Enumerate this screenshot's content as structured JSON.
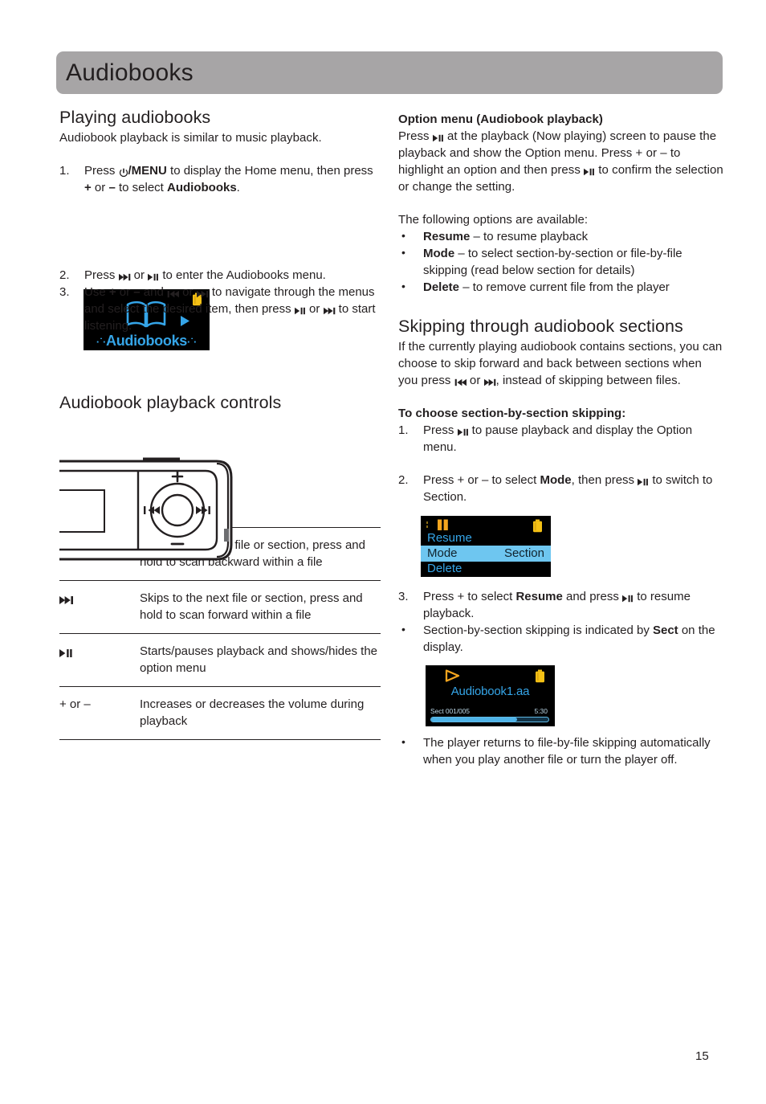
{
  "header": {
    "title": "Audiobooks"
  },
  "page_number": "15",
  "colors": {
    "header_bar": "#a7a5a6",
    "lcd_text_blue": "#35a5e8",
    "lcd_highlight": "#6ec6f0",
    "lcd_battery_yellow": "#f5c115",
    "lcd_accent_orange": "#f5a51e",
    "text": "#231f20"
  },
  "left_column": {
    "playing": {
      "heading": "Playing audiobooks",
      "intro": "Audiobook playback is similar to music playback.",
      "steps": [
        {
          "num": "1.",
          "parts": [
            {
              "t": "Press ",
              "s": "n"
            },
            {
              "t": "/MENU",
              "s": "b"
            },
            {
              "t": " to display the Home menu, then press ",
              "s": "n"
            },
            {
              "t": "+",
              "s": "b"
            },
            {
              "t": " or ",
              "s": "n"
            },
            {
              "t": "–",
              "s": "b"
            },
            {
              "t": " to select ",
              "s": "n"
            },
            {
              "t": "Audiobooks",
              "s": "b"
            },
            {
              "t": ".",
              "s": "n"
            }
          ]
        },
        {
          "num": "2.",
          "text_a": "Press ",
          "text_b": " or ",
          "text_c": " to enter the Audiobooks menu."
        },
        {
          "num": "3.",
          "text_a": "Use + or – and ",
          "text_b": " or ",
          "text_c": " to navigate through the menus and select the desired item, then press ",
          "text_d": " or ",
          "text_e": " to start listening."
        }
      ]
    },
    "home_screen": {
      "label": "Audiobooks",
      "dots_left": "·˙·",
      "dots_right": "·˙·",
      "icons": {
        "book": "book-icon",
        "play": "play-arrow-icon",
        "battery": "battery-icon"
      }
    },
    "controls": {
      "heading": "Audiobook playback controls",
      "device_labels": {
        "plus": "+",
        "minus": "–"
      },
      "rows": [
        {
          "key_icon": "skip-back-icon",
          "key_text": "",
          "desc": "Skips to previous file or section, press and hold to scan backward within a file"
        },
        {
          "key_icon": "skip-forward-icon",
          "key_text": "",
          "desc": "Skips to the next file or section, press and hold to scan forward within a file"
        },
        {
          "key_icon": "play-pause-icon",
          "key_text": "",
          "desc": "Starts/pauses playback and shows/hides the option menu"
        },
        {
          "key_icon": "",
          "key_text": "+ or –",
          "desc": "Increases or decreases the volume during playback"
        }
      ]
    }
  },
  "right_column": {
    "option_menu": {
      "heading": "Option menu (Audiobook playback)",
      "para_1a": "Press ",
      "para_1b": " at the playback (Now playing) screen to pause the playback and show the Option menu. Press + or – to highlight an option and then press ",
      "para_1c": " to confirm the selection or change the setting.",
      "options_intro": "The following options are available:",
      "options": [
        {
          "bullet": "•",
          "term": "Resume",
          "desc": " – to resume playback"
        },
        {
          "bullet": "•",
          "term": "Mode",
          "desc": " – to select section-by-section or file-by-file skipping (read below section for details)"
        },
        {
          "bullet": "•",
          "term": "Delete",
          "desc": " – to remove current file from the player"
        }
      ]
    },
    "skipping": {
      "heading": "Skipping through audiobook sections",
      "intro_a": "If the currently playing audiobook contains sections, you can choose to skip forward and back between sections when you press ",
      "intro_b": " or ",
      "intro_c": ", instead of skipping between files.",
      "subheading": "To choose section-by-section skipping:",
      "step_1": {
        "num": "1.",
        "a": "Press ",
        "b": " to pause playback and display the Option menu."
      },
      "step_2": {
        "num": "2.",
        "a": "Press + or – to select ",
        "term": "Mode",
        "b": ", then press ",
        "c": " to switch to Section."
      },
      "step_3": {
        "num": "3.",
        "a": "Press + to select ",
        "term": "Resume",
        "b": " and press ",
        "c": " to resume playback."
      },
      "bullet_1": {
        "bullet": "•",
        "a": "Section-by-section skipping is indicated by ",
        "term": "Sect",
        "b": " on the display."
      },
      "bullet_2": {
        "bullet": "•",
        "a": "The player returns to file-by-file skipping automatically when you play another file or turn the player off."
      }
    },
    "option_screen": {
      "items": [
        {
          "label": "Resume",
          "value": "",
          "selected": false
        },
        {
          "label": "Mode",
          "value": "Section",
          "selected": true
        },
        {
          "label": "Delete",
          "value": "",
          "selected": false
        }
      ],
      "icons": {
        "pause": "pause-icon",
        "battery": "battery-icon"
      }
    },
    "playback_screen": {
      "title": "Audiobook1.aa",
      "section": "Sect 001/005",
      "time": "5:30",
      "progress_percent": 73,
      "icons": {
        "play": "play-triangle-icon",
        "battery": "battery-icon"
      }
    }
  }
}
